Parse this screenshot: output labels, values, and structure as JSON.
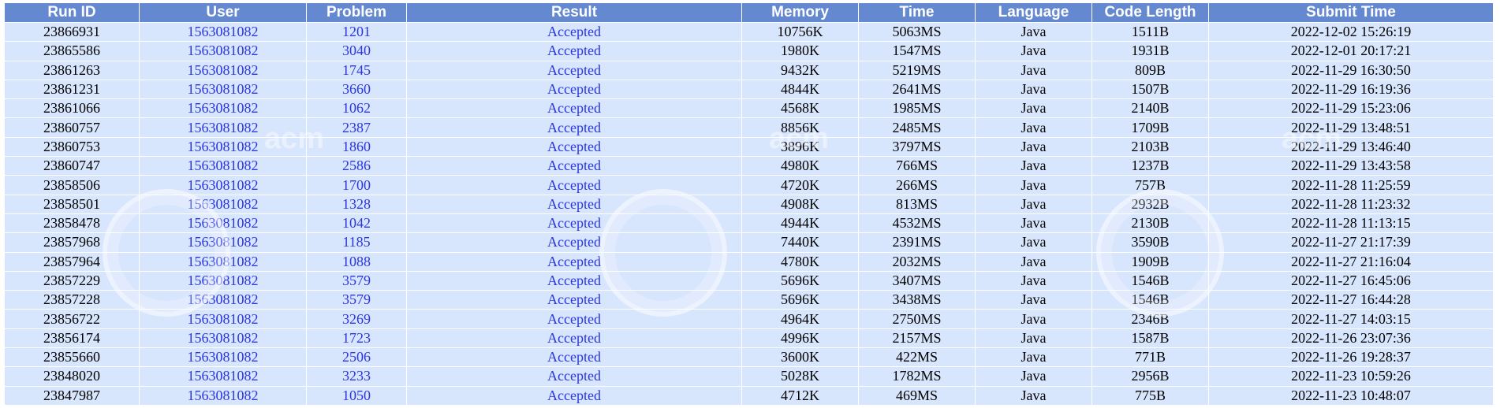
{
  "table": {
    "columns": [
      "Run ID",
      "User",
      "Problem",
      "Result",
      "Memory",
      "Time",
      "Language",
      "Code Length",
      "Submit Time"
    ],
    "rows": [
      [
        "23866931",
        "1563081082",
        "1201",
        "Accepted",
        "10756K",
        "5063MS",
        "Java",
        "1511B",
        "2022-12-02 15:26:19"
      ],
      [
        "23865586",
        "1563081082",
        "3040",
        "Accepted",
        "1980K",
        "1547MS",
        "Java",
        "1931B",
        "2022-12-01 20:17:21"
      ],
      [
        "23861263",
        "1563081082",
        "1745",
        "Accepted",
        "9432K",
        "5219MS",
        "Java",
        "809B",
        "2022-11-29 16:30:50"
      ],
      [
        "23861231",
        "1563081082",
        "3660",
        "Accepted",
        "4844K",
        "2641MS",
        "Java",
        "1507B",
        "2022-11-29 16:19:36"
      ],
      [
        "23861066",
        "1563081082",
        "1062",
        "Accepted",
        "4568K",
        "1985MS",
        "Java",
        "2140B",
        "2022-11-29 15:23:06"
      ],
      [
        "23860757",
        "1563081082",
        "2387",
        "Accepted",
        "8856K",
        "2485MS",
        "Java",
        "1709B",
        "2022-11-29 13:48:51"
      ],
      [
        "23860753",
        "1563081082",
        "1860",
        "Accepted",
        "3896K",
        "3797MS",
        "Java",
        "2103B",
        "2022-11-29 13:46:40"
      ],
      [
        "23860747",
        "1563081082",
        "2586",
        "Accepted",
        "4980K",
        "766MS",
        "Java",
        "1237B",
        "2022-11-29 13:43:58"
      ],
      [
        "23858506",
        "1563081082",
        "1700",
        "Accepted",
        "4720K",
        "266MS",
        "Java",
        "757B",
        "2022-11-28 11:25:59"
      ],
      [
        "23858501",
        "1563081082",
        "1328",
        "Accepted",
        "4908K",
        "813MS",
        "Java",
        "2932B",
        "2022-11-28 11:23:32"
      ],
      [
        "23858478",
        "1563081082",
        "1042",
        "Accepted",
        "4944K",
        "4532MS",
        "Java",
        "2130B",
        "2022-11-28 11:13:15"
      ],
      [
        "23857968",
        "1563081082",
        "1185",
        "Accepted",
        "7440K",
        "2391MS",
        "Java",
        "3590B",
        "2022-11-27 21:17:39"
      ],
      [
        "23857964",
        "1563081082",
        "1088",
        "Accepted",
        "4780K",
        "2032MS",
        "Java",
        "1909B",
        "2022-11-27 21:16:04"
      ],
      [
        "23857229",
        "1563081082",
        "3579",
        "Accepted",
        "5696K",
        "3407MS",
        "Java",
        "1546B",
        "2022-11-27 16:45:06"
      ],
      [
        "23857228",
        "1563081082",
        "3579",
        "Accepted",
        "5696K",
        "3438MS",
        "Java",
        "1546B",
        "2022-11-27 16:44:28"
      ],
      [
        "23856722",
        "1563081082",
        "3269",
        "Accepted",
        "4964K",
        "2750MS",
        "Java",
        "2346B",
        "2022-11-27 14:03:15"
      ],
      [
        "23856174",
        "1563081082",
        "1723",
        "Accepted",
        "4996K",
        "2157MS",
        "Java",
        "1587B",
        "2022-11-26 23:07:36"
      ],
      [
        "23855660",
        "1563081082",
        "2506",
        "Accepted",
        "3600K",
        "422MS",
        "Java",
        "771B",
        "2022-11-26 19:28:37"
      ],
      [
        "23848020",
        "1563081082",
        "3233",
        "Accepted",
        "5028K",
        "1782MS",
        "Java",
        "2956B",
        "2022-11-23 10:59:26"
      ],
      [
        "23847987",
        "1563081082",
        "1050",
        "Accepted",
        "4712K",
        "469MS",
        "Java",
        "775B",
        "2022-11-23 10:48:07"
      ]
    ]
  },
  "watermark": {
    "acm_text": "acm"
  },
  "colors": {
    "header_bg": "#6589d1",
    "row_bg": "#d7e5fd",
    "link": "#2b36e0"
  }
}
